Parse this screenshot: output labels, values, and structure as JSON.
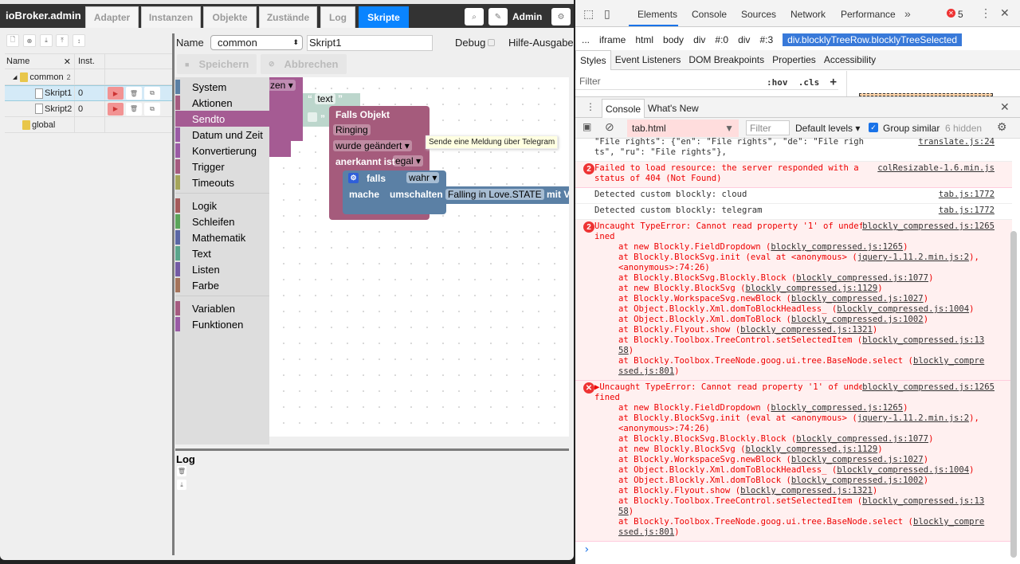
{
  "app": {
    "brand": "ioBroker.admin",
    "tabs": [
      "Adapter",
      "Instanzen",
      "Objekte",
      "Zustände",
      "Log",
      "Skripte"
    ],
    "active_tab": "Skripte",
    "user": "Admin"
  },
  "tree": {
    "headers": {
      "name": "Name",
      "inst": "Inst."
    },
    "rows": [
      {
        "name": "common",
        "count": "2",
        "inst": ""
      },
      {
        "name": "Skript1",
        "inst": "0"
      },
      {
        "name": "Skript2",
        "inst": "0"
      },
      {
        "name": "global",
        "inst": ""
      }
    ]
  },
  "editor": {
    "name_label": "Name",
    "folder": "common",
    "script_name": "Skript1",
    "debug_label": "Debug",
    "help_label": "Hilfe-Ausgabe",
    "save": "Speichern",
    "cancel": "Abbrechen"
  },
  "toolbox": {
    "items": [
      {
        "label": "System",
        "color": "#5b80a5"
      },
      {
        "label": "Aktionen",
        "color": "#a55b80"
      },
      {
        "label": "Sendto",
        "color": "#a55b93"
      },
      {
        "label": "Datum und Zeit",
        "color": "#9a5ba5"
      },
      {
        "label": "Konvertierung",
        "color": "#9a5ba5"
      },
      {
        "label": "Trigger",
        "color": "#a55b80"
      },
      {
        "label": "Timeouts",
        "color": "#a5a55b"
      }
    ],
    "items2": [
      {
        "label": "Logik",
        "color": "#a55b5b"
      },
      {
        "label": "Schleifen",
        "color": "#5ba55b"
      },
      {
        "label": "Mathematik",
        "color": "#5b67a5"
      },
      {
        "label": "Text",
        "color": "#5ba58c"
      },
      {
        "label": "Listen",
        "color": "#745ba5"
      },
      {
        "label": "Farbe",
        "color": "#a5745b"
      }
    ],
    "items3": [
      {
        "label": "Variablen",
        "color": "#a55b80"
      },
      {
        "label": "Funktionen",
        "color": "#995ba5"
      }
    ]
  },
  "blocks": {
    "partial_dropdown": "zen",
    "text_field": "text",
    "trigger_title": "Falls Objekt",
    "object": "Ringing",
    "condition": "wurde geändert",
    "ack_label": "anerkannt ist",
    "ack_value": "egal",
    "if_label": "falls",
    "if_value": "wahr",
    "do_label": "mache",
    "toggle_label": "umschalten",
    "toggle_target": "Falling in Love.STATE",
    "toggle_suffix": "mit Ve"
  },
  "tooltip": "Sende eine Meldung über Telegram",
  "log": {
    "title": "Log"
  },
  "devtools": {
    "tabs": [
      "Elements",
      "Console",
      "Sources",
      "Network",
      "Performance"
    ],
    "active_tab": "Elements",
    "error_count": "5",
    "breadcrumbs": [
      "...",
      "iframe",
      "html",
      "body",
      "div",
      "#:0",
      "div",
      "#:3"
    ],
    "selected_crumb": "div.blocklyTreeRow.blocklyTreeSelected",
    "style_tabs": [
      "Styles",
      "Event Listeners",
      "DOM Breakpoints",
      "Properties",
      "Accessibility"
    ],
    "styles_filter": "Filter",
    "hov": ":hov",
    "cls": ".cls",
    "drawer_tabs": [
      "Console",
      "What's New"
    ],
    "console": {
      "context": "tab.html",
      "filter_placeholder": "Filter",
      "levels": "Default levels",
      "group_similar": "Group similar",
      "hidden": "6 hidden",
      "messages": [
        {
          "type": "log",
          "text": "\"File rights\": {\"en\": \"File rights\", \"de\": \"File rights\", \"ru\": \"File rights\"},",
          "src": "translate.js:24"
        },
        {
          "type": "error",
          "badge": "2",
          "text": "Failed to load resource: the server responded with a status of 404 (Not Found)",
          "src": "colResizable-1.6.min.js"
        },
        {
          "type": "log",
          "text": "Detected custom blockly: cloud",
          "src": "tab.js:1772"
        },
        {
          "type": "log",
          "text": "Detected custom blockly: telegram",
          "src": "tab.js:1772"
        },
        {
          "type": "error",
          "badge": "2",
          "text": "Uncaught TypeError: Cannot read property '1' of undefined",
          "src": "blockly_compressed.js:1265"
        },
        {
          "type": "error",
          "badge": "x",
          "text": "▶Uncaught TypeError: Cannot read property '1' of undefined",
          "src": "blockly_compressed.js:1265"
        }
      ],
      "stack": [
        {
          "pre": "at new Blockly.FieldDropdown (",
          "link": "blockly_compressed.js:1265",
          "post": ")"
        },
        {
          "pre": "at Blockly.BlockSvg.init (eval at <anonymous> (",
          "link": "jquery-1.11.2.min.js:2",
          "post": "), <anonymous>:74:26)"
        },
        {
          "pre": "at Blockly.BlockSvg.Blockly.Block (",
          "link": "blockly_compressed.js:1077",
          "post": ")"
        },
        {
          "pre": "at new Blockly.BlockSvg (",
          "link": "blockly_compressed.js:1129",
          "post": ")"
        },
        {
          "pre": "at Blockly.WorkspaceSvg.newBlock (",
          "link": "blockly_compressed.js:1027",
          "post": ")"
        },
        {
          "pre": "at Object.Blockly.Xml.domToBlockHeadless_ (",
          "link": "blockly_compressed.js:1004",
          "post": ")"
        },
        {
          "pre": "at Object.Blockly.Xml.domToBlock (",
          "link": "blockly_compressed.js:1002",
          "post": ")"
        },
        {
          "pre": "at Blockly.Flyout.show (",
          "link": "blockly_compressed.js:1321",
          "post": ")"
        },
        {
          "pre": "at Blockly.Toolbox.TreeControl.setSelectedItem (",
          "link": "blockly_compressed.js:1358",
          "post": ")"
        },
        {
          "pre": "at Blockly.Toolbox.TreeNode.goog.ui.tree.BaseNode.select (",
          "link": "blockly_compressed.js:801",
          "post": ")"
        }
      ],
      "prompt": "›"
    }
  }
}
